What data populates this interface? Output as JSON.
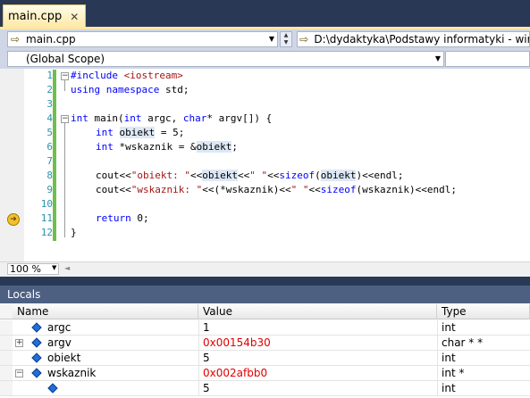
{
  "tab": {
    "title": "main.cpp"
  },
  "nav": {
    "file_combo": "main.cpp",
    "path_combo": "D:\\dydaktyka\\Podstawy informatyki - wirtote",
    "scope_combo": "(Global Scope)"
  },
  "editor": {
    "line_numbers": [
      "1",
      "2",
      "3",
      "4",
      "5",
      "6",
      "7",
      "8",
      "9",
      "10",
      "11",
      "12"
    ],
    "code": {
      "l1_kw": "#include ",
      "l1_str": "<iostream>",
      "l2_kw": "using namespace",
      "l2_rest": " std;",
      "l4_kw1": "int",
      "l4_mid1": " main(",
      "l4_kw2": "int",
      "l4_mid2": " argc, ",
      "l4_kw3": "char",
      "l4_rest": "* argv[]) {",
      "l5_kw": "int",
      "l5_sp": " ",
      "l5_hl": "obiekt",
      "l5_rest": " = 5;",
      "l6_kw": "int",
      "l6_mid": " *wskaznik = &",
      "l6_hl": "obiekt",
      "l6_rest": ";",
      "l8_a": "cout<<",
      "l8_str1": "\"obiekt: \"",
      "l8_b": "<<",
      "l8_hl1": "obiekt",
      "l8_c": "<<",
      "l8_str2": "\" \"",
      "l8_d": "<<",
      "l8_kw": "sizeof",
      "l8_e": "(",
      "l8_hl2": "obiekt",
      "l8_f": ")<<endl;",
      "l9_a": "cout<<",
      "l9_str1": "\"wskaznik: \"",
      "l9_b": "<<(*wskaznik)<<",
      "l9_str2": "\" \"",
      "l9_c": "<<",
      "l9_kw": "sizeof",
      "l9_d": "(wskaznik)<<endl;",
      "l11_kw": "return",
      "l11_rest": " 0;",
      "l12": "}"
    },
    "zoom": "100 %"
  },
  "locals": {
    "title": "Locals",
    "columns": [
      "Name",
      "Value",
      "Type"
    ],
    "rows": [
      {
        "name": "argc",
        "value": "1",
        "type": "int"
      },
      {
        "name": "argv",
        "value": "0x00154b30",
        "type": "char * *",
        "expander": "+"
      },
      {
        "name": "obiekt",
        "value": "5",
        "type": "int"
      },
      {
        "name": "wskaznik",
        "value": "0x002afbb0",
        "type": "int *",
        "expander": "−"
      },
      {
        "name": "",
        "value": "5",
        "type": "int"
      }
    ]
  },
  "colors": {
    "frame": "#293955",
    "tab_active": "#ffe8a6",
    "keyword": "#0000ff",
    "string": "#a31515",
    "changed_value": "#e00000",
    "line_number": "#2b91af"
  }
}
